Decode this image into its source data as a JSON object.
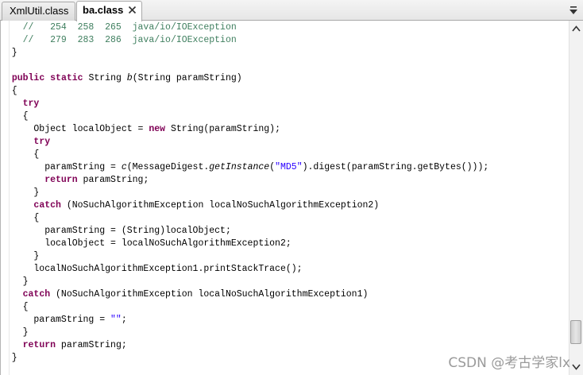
{
  "tabs": [
    {
      "label": "XmlUtil.class",
      "active": false
    },
    {
      "label": "ba.class",
      "active": true
    }
  ],
  "editor": {
    "lines": [
      [
        {
          "t": "    "
        },
        {
          "t": "//   254  258  265  java/io/IOException",
          "c": "cm"
        }
      ],
      [
        {
          "t": "    "
        },
        {
          "t": "//   279  283  286  java/io/IOException",
          "c": "cm"
        }
      ],
      [
        {
          "t": "  }"
        }
      ],
      [
        {
          "t": ""
        }
      ],
      [
        {
          "t": "  "
        },
        {
          "t": "public",
          "c": "kw"
        },
        {
          "t": " "
        },
        {
          "t": "static",
          "c": "kw"
        },
        {
          "t": " String "
        },
        {
          "t": "b",
          "c": "it"
        },
        {
          "t": "(String paramString)"
        }
      ],
      [
        {
          "t": "  {"
        }
      ],
      [
        {
          "t": "    "
        },
        {
          "t": "try",
          "c": "kw"
        }
      ],
      [
        {
          "t": "    {"
        }
      ],
      [
        {
          "t": "      Object localObject = "
        },
        {
          "t": "new",
          "c": "kw"
        },
        {
          "t": " String(paramString);"
        }
      ],
      [
        {
          "t": "      "
        },
        {
          "t": "try",
          "c": "kw"
        }
      ],
      [
        {
          "t": "      {"
        }
      ],
      [
        {
          "t": "        paramString = "
        },
        {
          "t": "c",
          "c": "it"
        },
        {
          "t": "(MessageDigest."
        },
        {
          "t": "getInstance",
          "c": "it"
        },
        {
          "t": "("
        },
        {
          "t": "\"MD5\"",
          "c": "str"
        },
        {
          "t": ").digest(paramString.getBytes()));"
        }
      ],
      [
        {
          "t": "        "
        },
        {
          "t": "return",
          "c": "kw"
        },
        {
          "t": " paramString;"
        }
      ],
      [
        {
          "t": "      }"
        }
      ],
      [
        {
          "t": "      "
        },
        {
          "t": "catch",
          "c": "kw"
        },
        {
          "t": " (NoSuchAlgorithmException localNoSuchAlgorithmException2)"
        }
      ],
      [
        {
          "t": "      {"
        }
      ],
      [
        {
          "t": "        paramString = (String)localObject;"
        }
      ],
      [
        {
          "t": "        localObject = localNoSuchAlgorithmException2;"
        }
      ],
      [
        {
          "t": "      }"
        }
      ],
      [
        {
          "t": "      localNoSuchAlgorithmException1.printStackTrace();"
        }
      ],
      [
        {
          "t": "    }"
        }
      ],
      [
        {
          "t": "    "
        },
        {
          "t": "catch",
          "c": "kw"
        },
        {
          "t": " (NoSuchAlgorithmException localNoSuchAlgorithmException1)"
        }
      ],
      [
        {
          "t": "    {"
        }
      ],
      [
        {
          "t": "      paramString = "
        },
        {
          "t": "\"\"",
          "c": "str"
        },
        {
          "t": ";"
        }
      ],
      [
        {
          "t": "    }"
        }
      ],
      [
        {
          "t": "    "
        },
        {
          "t": "return",
          "c": "kw"
        },
        {
          "t": " paramString;"
        }
      ],
      [
        {
          "t": "  }"
        }
      ]
    ]
  },
  "colors": {
    "keyword": "#7f0055",
    "comment": "#3f7f5f",
    "string": "#2a00ff"
  },
  "icons": {
    "tab_close": "close-icon",
    "tab_menu": "chevron-down-icon",
    "scroll_up": "arrow-up-icon",
    "scroll_down": "arrow-down-icon"
  },
  "watermark": "CSDN @考古学家lx"
}
